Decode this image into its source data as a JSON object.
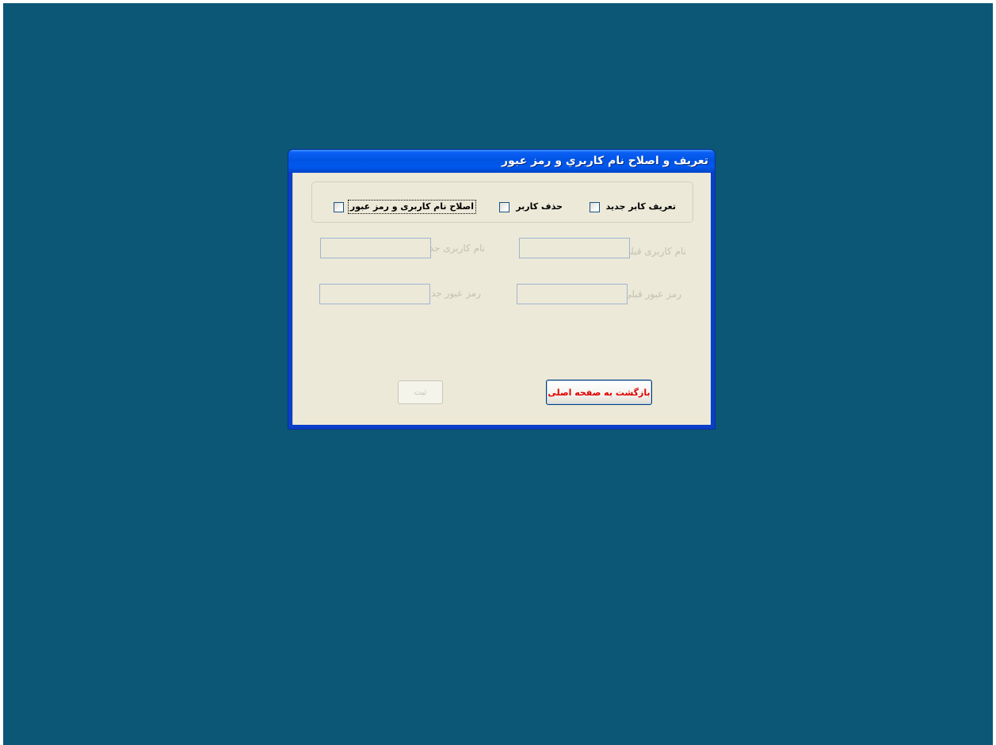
{
  "window": {
    "title": "تعريف و اصلاح نام كاربري و رمز عبور"
  },
  "options": {
    "new_user": {
      "label": "تعریف کابر جدید",
      "checked": false
    },
    "delete_user": {
      "label": "حذف کاربر",
      "checked": false
    },
    "edit_credentials": {
      "label": "اصلاح نام کاربری و رمز عبور",
      "checked": false
    }
  },
  "fields": {
    "old_username": {
      "label": "نام کاربری قبلی",
      "value": "",
      "enabled": false
    },
    "new_username": {
      "label": "نام کاربری جدید",
      "value": "",
      "enabled": false
    },
    "old_password": {
      "label": "رمز عبور قبلی",
      "value": "",
      "enabled": false
    },
    "new_password": {
      "label": "رمز عبور جدید",
      "value": "",
      "enabled": false
    }
  },
  "buttons": {
    "back_label": "بازگشت به صفحه اصلی",
    "submit_label": "ثبت",
    "submit_enabled": false
  },
  "colors": {
    "desktop": "#0b5775",
    "titlebar": "#0054e3",
    "client": "#ece9d8",
    "back_button_text": "#e00000",
    "disabled_text": "#c4c1b3"
  }
}
